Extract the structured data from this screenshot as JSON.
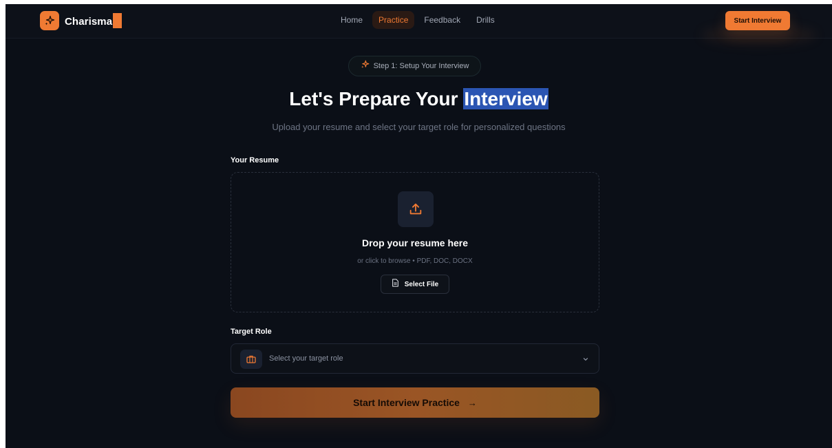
{
  "brand": {
    "name": "Charisma",
    "accent": "#f07a33",
    "icon": "sparkles-icon"
  },
  "nav": {
    "links": [
      "Home",
      "Practice",
      "Feedback",
      "Drills"
    ],
    "active": "Practice",
    "cta_label": "Start Interview"
  },
  "step": {
    "label": "Step 1: Setup Your Interview",
    "icon": "sparkles-icon"
  },
  "hero": {
    "title_prefix": "Let's Prepare Your ",
    "title_highlight": "Interview",
    "subtitle": "Upload your resume and select your target role for personalized questions"
  },
  "resume": {
    "section_label": "Your Resume",
    "icon": "upload-icon",
    "drop_title": "Drop your resume here",
    "drop_hint": "or click to browse • PDF, DOC, DOCX",
    "select_file_label": "Select File",
    "select_file_icon": "file-icon"
  },
  "role": {
    "section_label": "Target Role",
    "icon": "briefcase-icon",
    "placeholder": "Select your target role",
    "chevron": "chevron-down-icon"
  },
  "submit": {
    "label": "Start Interview Practice",
    "arrow": "→"
  }
}
